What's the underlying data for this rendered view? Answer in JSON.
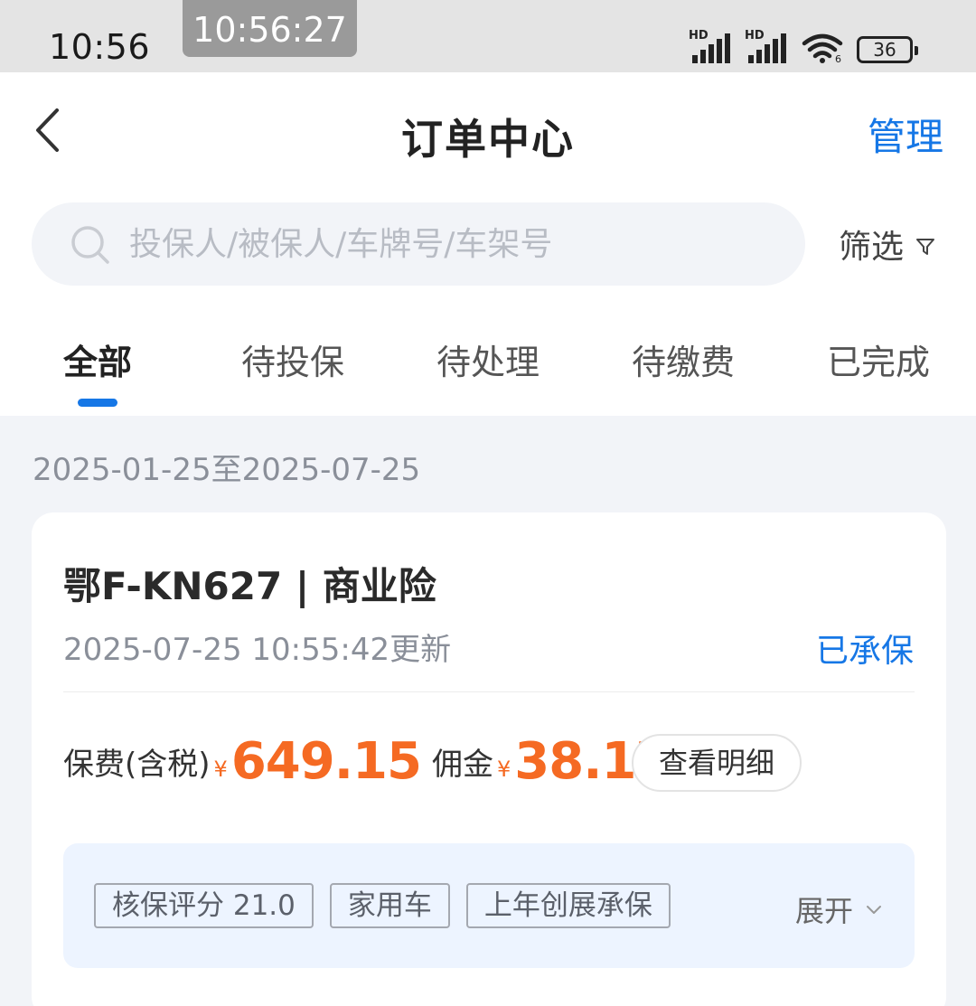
{
  "status_bar": {
    "time": "10:56",
    "overlay_time": "10:56:27",
    "signal1_label": "HD",
    "signal2_label": "HD",
    "wifi_icon": "wifi-6-icon",
    "battery": "36"
  },
  "header": {
    "back_icon": "chevron-left-icon",
    "title": "订单中心",
    "manage_label": "管理"
  },
  "search": {
    "placeholder": "投保人/被保人/车牌号/车架号",
    "value": "",
    "icon": "search-icon"
  },
  "filter": {
    "label": "筛选",
    "icon": "funnel-icon"
  },
  "tabs": [
    {
      "label": "全部",
      "active": true
    },
    {
      "label": "待投保",
      "active": false
    },
    {
      "label": "待处理",
      "active": false
    },
    {
      "label": "待缴费",
      "active": false
    },
    {
      "label": "已完成",
      "active": false
    }
  ],
  "date_range": "2025-01-25至2025-07-25",
  "order": {
    "title": "鄂F-KN627 | 商业险",
    "updated": "2025-07-25 10:55:42更新",
    "status": "已承保",
    "premium_label": "保费(含税)",
    "currency": "¥",
    "premium": "649.15",
    "commission_label": "佣金",
    "commission": "38.17",
    "detail_button": "查看明细",
    "tags": [
      "核保评分 21.0",
      "家用车",
      "上年创展承保"
    ],
    "expand_label": "展开",
    "expand_icon": "chevron-down-icon"
  },
  "colors": {
    "accent": "#1677e6",
    "price": "#f56a23",
    "background": "#f2f4f8"
  }
}
